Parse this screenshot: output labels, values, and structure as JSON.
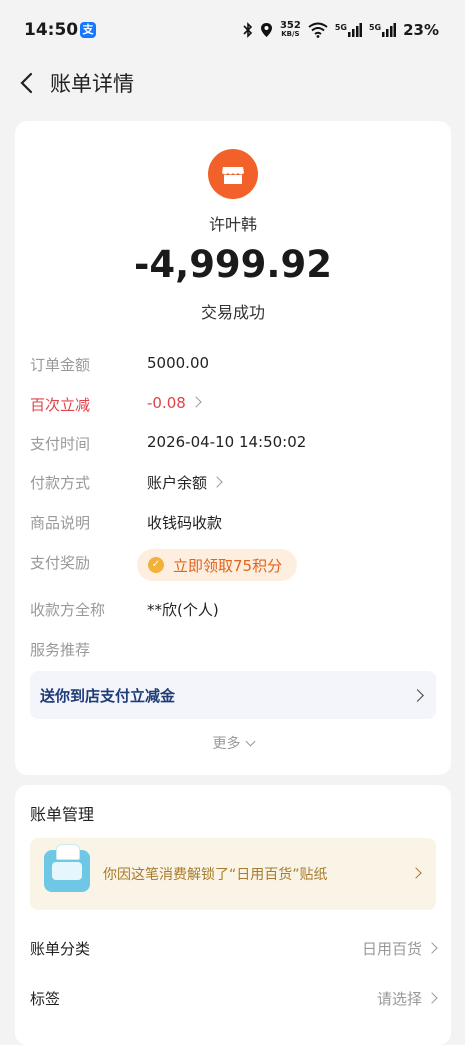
{
  "status_bar": {
    "time": "14:50",
    "app_badge": "支",
    "net_speed_top": "352",
    "net_speed_bottom": "KB/S",
    "sig1_label": "5G",
    "sig2_label": "5G",
    "battery": "23%"
  },
  "header": {
    "title": "账单详情"
  },
  "summary": {
    "payee": "许叶韩",
    "amount": "-4,999.92",
    "status": "交易成功"
  },
  "details": {
    "order_amount_label": "订单金额",
    "order_amount": "5000.00",
    "discount_label": "百次立减",
    "discount": "-0.08",
    "pay_time_label": "支付时间",
    "pay_time": "2026-04-10 14:50:02",
    "pay_method_label": "付款方式",
    "pay_method": "账户余额",
    "goods_label": "商品说明",
    "goods": "收钱码收款",
    "reward_label": "支付奖励",
    "reward": "立即领取75积分",
    "payee_full_label": "收款方全称",
    "payee_full": "**欣(个人)",
    "service_label": "服务推荐",
    "promo": "送你到店支付立减金",
    "more": "更多"
  },
  "bill_mgmt": {
    "heading": "账单管理",
    "sticker_text": "你因这笔消费解锁了“日用百货”贴纸",
    "category_label": "账单分类",
    "category_value": "日用百货",
    "tag_label": "标签",
    "tag_value": "请选择"
  },
  "colors": {
    "accent_red": "#e0434a",
    "shop_icon": "#f2612a",
    "reward_bg": "#fdeee0"
  }
}
